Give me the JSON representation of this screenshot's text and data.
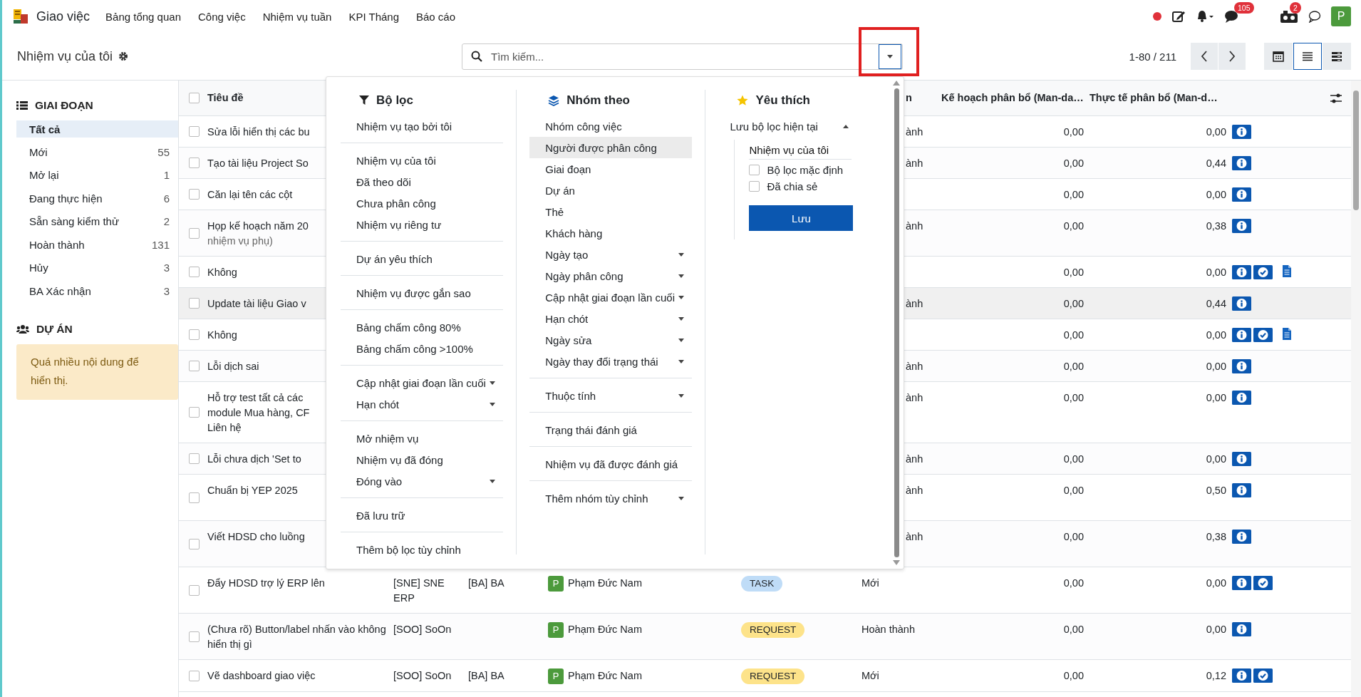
{
  "navbar": {
    "app_name": "Giao việc",
    "menu": [
      "Bảng tổng quan",
      "Công việc",
      "Nhiệm vụ tuần",
      "KPI Tháng",
      "Báo cáo"
    ],
    "messages_badge": "105",
    "activity_badge": "2",
    "avatar": "P"
  },
  "control_panel": {
    "breadcrumb": "Nhiệm vụ của tôi",
    "search": {
      "placeholder": "Tìm kiếm..."
    },
    "pager": "1-80 / 211",
    "views": [
      {
        "kind": "calendar",
        "selected": false
      },
      {
        "kind": "list",
        "selected": true
      },
      {
        "kind": "rows",
        "selected": false
      }
    ]
  },
  "sidebar": {
    "sections": [
      {
        "kind": "list",
        "title": "GIAI ĐOẠN",
        "items": [
          {
            "label": "Tất cả",
            "selected": true
          },
          {
            "label": "Mới",
            "count": "55",
            "selected": false
          },
          {
            "label": "Mở lại",
            "count": "1",
            "selected": false
          },
          {
            "label": "Đang thực hiện",
            "count": "6",
            "selected": false
          },
          {
            "label": "Sẵn sàng kiểm thử",
            "count": "2",
            "selected": false
          },
          {
            "label": "Hoàn thành",
            "count": "131",
            "selected": false
          },
          {
            "label": "Hủy",
            "count": "3",
            "selected": false
          },
          {
            "label": "BA Xác nhận",
            "count": "3",
            "selected": false
          }
        ]
      },
      {
        "kind": "notice",
        "title": "DỰ ÁN",
        "message": "Quá nhiều nội dung để hiển thị."
      }
    ]
  },
  "table": {
    "header_checked": false,
    "columns": [
      {
        "label": "Tiêu đề",
        "kind": "title"
      },
      {
        "label": "n",
        "kind": "stage"
      },
      {
        "label": "Kế hoạch phân bổ (Man-da…",
        "kind": "plan"
      },
      {
        "label": "Thực tế phân bổ (Man-d…",
        "kind": "actual"
      }
    ],
    "rows": [
      {
        "title": "Sửa lỗi hiển thị các bu",
        "stage_tail": "ành",
        "plan": "0,00",
        "actual": "0,00",
        "info": true,
        "done": false,
        "document": false,
        "checked": false,
        "hovered": false
      },
      {
        "title": "Tạo tài liệu Project So",
        "stage_tail": "ành",
        "plan": "0,00",
        "actual": "0,44",
        "info": true,
        "done": false,
        "document": false,
        "checked": false,
        "hovered": false
      },
      {
        "title": "Căn lại tên các cột",
        "plan": "0,00",
        "actual": "0,00",
        "info": true,
        "done": false,
        "document": false,
        "checked": false,
        "hovered": false
      },
      {
        "title": "Họp kế hoạch năm 20",
        "subtitle": "nhiệm vụ phụ)",
        "stage_tail": "ành",
        "plan": "0,00",
        "actual": "0,38",
        "info": true,
        "done": false,
        "document": false,
        "checked": false,
        "hovered": false
      },
      {
        "title": "Không",
        "plan": "0,00",
        "actual": "0,00",
        "info": true,
        "done": true,
        "document": true,
        "checked": false,
        "hovered": false
      },
      {
        "title": "Update tài liệu Giao v",
        "stage_tail": "ành",
        "plan": "0,00",
        "actual": "0,44",
        "info": true,
        "done": false,
        "document": false,
        "checked": false,
        "hovered": true
      },
      {
        "title": "Không",
        "plan": "0,00",
        "actual": "0,00",
        "info": true,
        "done": true,
        "document": true,
        "checked": false,
        "hovered": false
      },
      {
        "title": "Lỗi dịch sai",
        "stage_tail": "ành",
        "plan": "0,00",
        "actual": "0,00",
        "info": true,
        "done": false,
        "document": false,
        "checked": false,
        "hovered": false
      },
      {
        "title_lines": [
          "Hỗ trợ test tất cả các",
          "module Mua hàng, CF",
          "Liên hệ"
        ],
        "stage_tail": "ành",
        "plan": "0,00",
        "actual": "0,00",
        "info": true,
        "done": false,
        "document": false,
        "checked": false,
        "hovered": false
      },
      {
        "title": "Lỗi chưa dịch 'Set to",
        "stage_tail": "ành",
        "plan": "0,00",
        "actual": "0,00",
        "info": true,
        "done": false,
        "document": false,
        "checked": false,
        "hovered": false
      },
      {
        "title": "Chuẩn bị YEP 2025",
        "stage_tail": "ành",
        "plan": "0,00",
        "actual": "0,50",
        "info": true,
        "done": false,
        "document": false,
        "checked": false,
        "hovered": false
      },
      {
        "title": "Viết HDSD cho luồng",
        "stage_tail": "ành",
        "plan": "0,00",
        "actual": "0,38",
        "info": true,
        "done": false,
        "document": false,
        "checked": false,
        "hovered": false
      },
      {
        "title": "Đẩy HDSD trợ lý ERP lên",
        "project": "[SNE] SNE ERP",
        "tag": "[BA] BA",
        "assignee": {
          "initial": "P",
          "name": "Phạm Đức Nam"
        },
        "type": {
          "label": "TASK",
          "color": "#bfdcf7"
        },
        "stage": "Mới",
        "plan": "0,00",
        "actual": "0,00",
        "info": true,
        "done": true,
        "document": false,
        "checked": false,
        "hovered": false
      },
      {
        "title": "(Chưa rõ) Button/label nhấn vào không hiển thị gì",
        "project": "[SOO] SoOn",
        "assignee": {
          "initial": "P",
          "name": "Phạm Đức Nam"
        },
        "type": {
          "label": "REQUEST",
          "color": "#fde38a"
        },
        "stage": "Hoàn thành",
        "plan": "0,00",
        "actual": "0,00",
        "info": true,
        "done": false,
        "document": false,
        "checked": false,
        "hovered": false
      },
      {
        "title": "Vẽ dashboard giao việc",
        "project": "[SOO] SoOn",
        "tag": "[BA] BA",
        "assignee": {
          "initial": "P",
          "name": "Phạm Đức Nam"
        },
        "type": {
          "label": "REQUEST",
          "color": "#fde38a"
        },
        "stage": "Mới",
        "plan": "0,00",
        "actual": "0,12",
        "info": true,
        "done": true,
        "document": false,
        "checked": false,
        "hovered": false
      }
    ]
  },
  "search_panel": {
    "filters": {
      "title": "Bộ lọc",
      "groups": [
        [
          {
            "label": "Nhiệm vụ tạo bởi tôi",
            "kind": "option"
          }
        ],
        [
          {
            "label": "Nhiệm vụ của tôi",
            "kind": "option"
          },
          {
            "label": "Đã theo dõi",
            "kind": "option"
          },
          {
            "label": "Chưa phân công",
            "kind": "option"
          },
          {
            "label": "Nhiệm vụ riêng tư",
            "kind": "option"
          }
        ],
        [
          {
            "label": "Dự án yêu thích",
            "kind": "option"
          }
        ],
        [
          {
            "label": "Nhiệm vụ được gắn sao",
            "kind": "option"
          }
        ],
        [
          {
            "label": "Bảng chấm công 80%",
            "kind": "option"
          },
          {
            "label": "Bảng chấm công >100%",
            "kind": "option"
          }
        ],
        [
          {
            "label": "Cập nhật giai đoạn lần cuối",
            "kind": "submenu"
          },
          {
            "label": "Hạn chót",
            "kind": "submenu"
          }
        ],
        [
          {
            "label": "Mở nhiệm vụ",
            "kind": "option"
          },
          {
            "label": "Nhiệm vụ đã đóng",
            "kind": "option"
          },
          {
            "label": "Đóng vào",
            "kind": "submenu"
          }
        ],
        [
          {
            "label": "Đã lưu trữ",
            "kind": "option"
          }
        ],
        [
          {
            "label": "Thêm bộ lọc tùy chỉnh",
            "kind": "option"
          }
        ]
      ]
    },
    "group_by": {
      "title": "Nhóm theo",
      "groups": [
        [
          {
            "label": "Nhóm công việc",
            "kind": "option",
            "highlighted": false
          },
          {
            "label": "Người được phân công",
            "kind": "option",
            "highlighted": true
          },
          {
            "label": "Giai đoạn",
            "kind": "option",
            "highlighted": false
          },
          {
            "label": "Dự án",
            "kind": "option",
            "highlighted": false
          },
          {
            "label": "Thẻ",
            "kind": "option",
            "highlighted": false
          },
          {
            "label": "Khách hàng",
            "kind": "option",
            "highlighted": false
          },
          {
            "label": "Ngày tạo",
            "kind": "submenu",
            "highlighted": false
          },
          {
            "label": "Ngày phân công",
            "kind": "submenu",
            "highlighted": false
          },
          {
            "label": "Cập nhật giai đoạn lần cuối",
            "kind": "submenu",
            "highlighted": false
          },
          {
            "label": "Hạn chót",
            "kind": "submenu",
            "highlighted": false
          },
          {
            "label": "Ngày sửa",
            "kind": "submenu",
            "highlighted": false
          },
          {
            "label": "Ngày thay đổi trạng thái",
            "kind": "submenu",
            "highlighted": false
          }
        ],
        [
          {
            "label": "Thuộc tính",
            "kind": "submenu",
            "highlighted": false
          }
        ],
        [
          {
            "label": "Trạng thái đánh giá",
            "kind": "option",
            "highlighted": false
          }
        ],
        [
          {
            "label": "Nhiệm vụ đã được đánh giá",
            "kind": "option",
            "highlighted": false
          }
        ],
        [
          {
            "label": "Thêm nhóm tùy chỉnh",
            "kind": "submenu",
            "highlighted": false
          }
        ]
      ]
    },
    "favorites": {
      "title": "Yêu thích",
      "save_label": "Lưu bộ lọc hiện tại",
      "expanded": true,
      "name_value": "Nhiệm vụ của tôi",
      "options": [
        {
          "label": "Bộ lọc mặc định",
          "checked": false
        },
        {
          "label": "Đã chia sẻ",
          "checked": false
        }
      ],
      "save_button": "Lưu"
    }
  }
}
